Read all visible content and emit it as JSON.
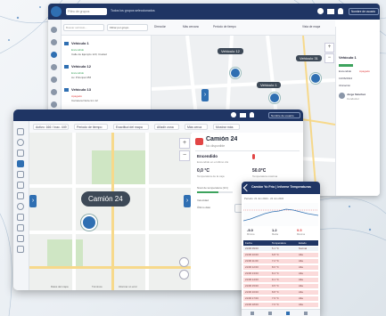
{
  "back_window": {
    "search_placeholder": "Filtro de grupos",
    "group_filter": "Todos los grupos seleccionados",
    "user_menu": "Nombre de usuario",
    "list_search_placeholder": "Buscar vehículo...",
    "list_filter": "Filtrar por grupo",
    "toolbar": [
      "Dirección",
      "Más cercano",
      "Periodo de tiempo",
      "Vista de mapa"
    ],
    "vehicles": [
      {
        "name": "Vehículo 1",
        "line1": "Encendido",
        "line2": "Calle de Ejemplo 123, Ciudad"
      },
      {
        "name": "Vehículo 12",
        "line1": "Encendido",
        "line2": "Av. Principal 456"
      },
      {
        "name": "Vehículo 13",
        "line1": "Apagado",
        "line2": "Carretera Norte km 12"
      },
      {
        "name": "Vehículo 31",
        "line1": "Encendido",
        "line2": "Zona Industrial"
      }
    ],
    "map_labels": [
      "Vehículo 12",
      "Vehículo 31",
      "Vehículo 1"
    ],
    "right_panel": {
      "title": "Vehículo 1",
      "lines": [
        "Encendido",
        "Apagado",
        "13/06/2024",
        "Ubicación",
        "Jorge Sánchez",
        "Conductor"
      ]
    }
  },
  "front_window": {
    "user_menu": "Nombre de usuario",
    "toolbar": [
      "Activo: 166 / Inac. 449",
      "Periodo de tiempo",
      "Exactitud del mapa",
      "Añadir zona",
      "Más cerca",
      "Mostrar más"
    ],
    "map_label": "Camión 24",
    "map_footer": [
      "Datos del mapa",
      "Términos",
      "Informar un error"
    ],
    "detail": {
      "title": "Camión 24",
      "subtitle": "No disponible",
      "status": "Encendido",
      "status_note": "Encendido en el último día",
      "speed": "0,0 °C",
      "speed_label": "Temperatura de la caja",
      "temp": "50.0°C",
      "temp_label": "Temperatura máxima",
      "rows": [
        "Nivel de temperatura (1/1)",
        "Velocidad",
        "Último dato"
      ],
      "button": "Centrar en el mapa"
    }
  },
  "phone": {
    "title": "Camión Yo Frío | Informe Temperaturas",
    "date_label": "Periodo: 21 Jun 2024 - 22 Jun 2024",
    "stats": [
      {
        "label": "Mínima",
        "value": "-5.0"
      },
      {
        "label": "Media",
        "value": "1.2"
      },
      {
        "label": "Máxima",
        "value": "9.5"
      }
    ],
    "table_headers": [
      "Fecha",
      "Temperatura",
      "Estado"
    ],
    "rows": [
      [
        "21/06 09:00",
        "5.1 °C",
        "Normal"
      ],
      [
        "21/06 10:00",
        "6.8 °C",
        "Alta"
      ],
      [
        "21/06 11:00",
        "7.2 °C",
        "Alta"
      ],
      [
        "21/06 12:00",
        "8.0 °C",
        "Alta"
      ],
      [
        "21/06 13:00",
        "8.4 °C",
        "Alta"
      ],
      [
        "21/06 14:00",
        "9.1 °C",
        "Alta"
      ],
      [
        "21/06 15:00",
        "9.5 °C",
        "Alta"
      ],
      [
        "21/06 16:00",
        "8.8 °C",
        "Alta"
      ],
      [
        "21/06 17:00",
        "7.9 °C",
        "Alta"
      ],
      [
        "21/06 18:00",
        "7.0 °C",
        "Alta"
      ]
    ]
  },
  "colors": {
    "navy": "#1f3564",
    "accent_blue": "#2f6fb2",
    "status_orange": "#f08a24",
    "alert_red": "#e24545",
    "ok_green": "#3da35d"
  }
}
